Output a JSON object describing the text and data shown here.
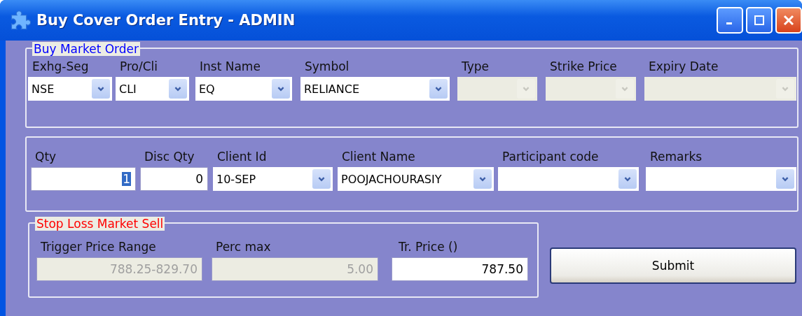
{
  "window": {
    "title": "Buy Cover Order Entry - ADMIN"
  },
  "groups": [
    {
      "legend": "Buy Market Order",
      "color": "#0000ff",
      "fields": [
        {
          "label": "Exhg-Seg",
          "kind": "combo",
          "value": "NSE",
          "disabled": false
        },
        {
          "label": "Pro/Cli",
          "kind": "combo",
          "value": "CLI",
          "disabled": false
        },
        {
          "label": "Inst Name",
          "kind": "combo",
          "value": "EQ",
          "disabled": false
        },
        {
          "label": "Symbol",
          "kind": "combo",
          "value": "RELIANCE",
          "disabled": false
        },
        {
          "label": "Type",
          "kind": "combo",
          "disabled": true
        },
        {
          "label": "Strike Price",
          "kind": "combo",
          "disabled": true
        },
        {
          "label": "Expiry Date",
          "kind": "combo",
          "disabled": true
        }
      ]
    },
    {
      "fields": [
        {
          "label": "Qty",
          "kind": "text",
          "value": "1",
          "disabled": false,
          "text_selected": true
        },
        {
          "label": "Disc Qty",
          "kind": "text",
          "value": "0",
          "disabled": false,
          "text_selected": false
        },
        {
          "label": "Client Id",
          "kind": "combo",
          "value": "10-SEP",
          "disabled": false
        },
        {
          "label": "Client Name",
          "kind": "combo",
          "value": "POOJACHOURASIY",
          "disabled": false
        },
        {
          "label": "Participant code",
          "kind": "combo",
          "disabled": false
        },
        {
          "label": "Remarks",
          "kind": "combo",
          "disabled": false
        }
      ]
    },
    {
      "legend": "Stop Loss Market Sell",
      "color": "#ff0000",
      "fields": [
        {
          "label": "Trigger Price Range",
          "kind": "text",
          "value": "788.25-829.70",
          "disabled": true,
          "text_selected": false
        },
        {
          "label": "Perc max",
          "kind": "text",
          "value": "5.00",
          "disabled": true,
          "text_selected": false
        },
        {
          "label": "Tr. Price ()",
          "kind": "text",
          "value": "787.50",
          "disabled": false,
          "text_selected": false
        }
      ]
    }
  ],
  "buttons": [
    {
      "label": "Submit"
    }
  ]
}
